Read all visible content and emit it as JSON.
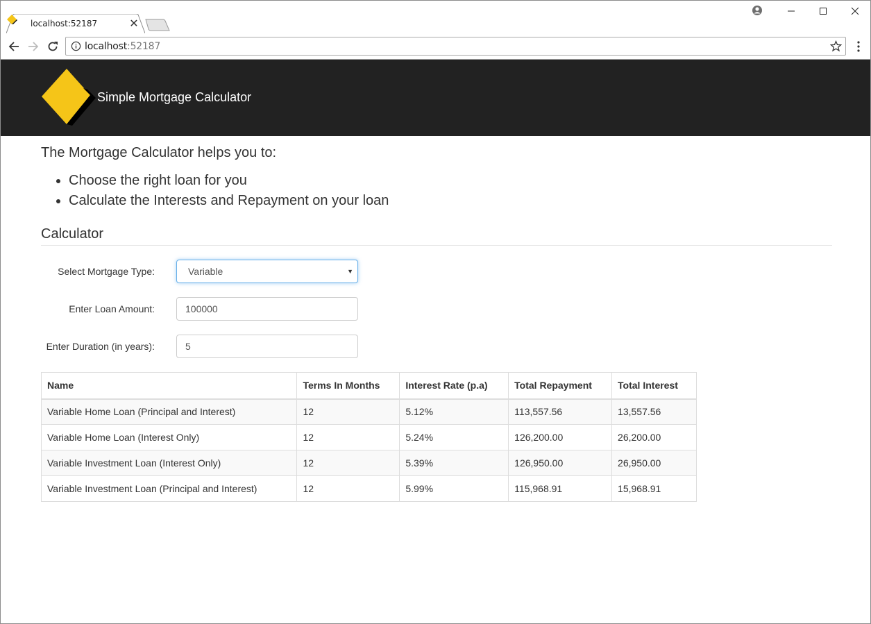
{
  "browser": {
    "tab_title": "localhost:52187",
    "url_host": "localhost",
    "url_port": ":52187"
  },
  "header": {
    "brand": "Simple Mortgage Calculator",
    "logo_color": "#F5C518"
  },
  "intro": {
    "heading": "The Mortgage Calculator helps you to:",
    "bullets": [
      "Choose the right loan for you",
      "Calculate the Interests and Repayment on your loan"
    ]
  },
  "calculator": {
    "title": "Calculator",
    "mortgage_type_label": "Select Mortgage Type:",
    "mortgage_type_value": "Variable",
    "loan_amount_label": "Enter Loan Amount:",
    "loan_amount_value": "100000",
    "duration_label": "Enter Duration (in years):",
    "duration_value": "5"
  },
  "table": {
    "columns": [
      "Name",
      "Terms In Months",
      "Interest Rate (p.a)",
      "Total Repayment",
      "Total Interest"
    ],
    "rows": [
      [
        "Variable Home Loan (Principal and Interest)",
        "12",
        "5.12%",
        "113,557.56",
        "13,557.56"
      ],
      [
        "Variable Home Loan (Interest Only)",
        "12",
        "5.24%",
        "126,200.00",
        "26,200.00"
      ],
      [
        "Variable Investment Loan (Interest Only)",
        "12",
        "5.39%",
        "126,950.00",
        "26,950.00"
      ],
      [
        "Variable Investment Loan (Principal and Interest)",
        "12",
        "5.99%",
        "115,968.91",
        "15,968.91"
      ]
    ]
  },
  "colors": {
    "header_bg": "#222222",
    "focus_border": "#66afe9"
  }
}
